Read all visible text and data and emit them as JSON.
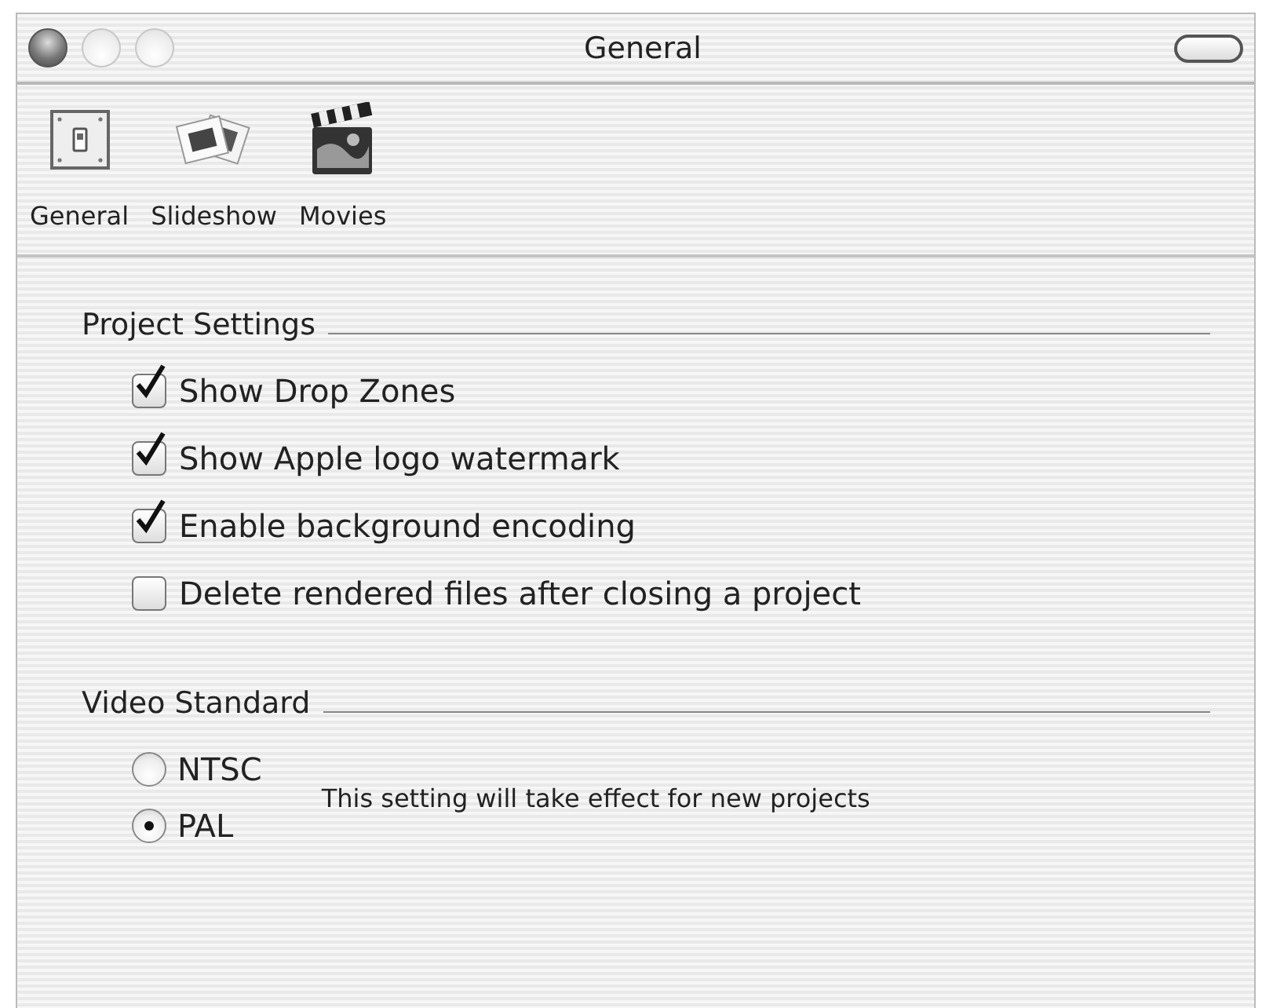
{
  "window": {
    "title": "General"
  },
  "toolbar": [
    {
      "kind": "switch",
      "label": "General"
    },
    {
      "kind": "slides",
      "label": "Slideshow"
    },
    {
      "kind": "clapper",
      "label": "Movies"
    }
  ],
  "sections": [
    {
      "title": "Project Settings",
      "checkboxes": [
        {
          "label": "Show Drop Zones",
          "checked": true
        },
        {
          "label": "Show Apple logo watermark",
          "checked": true
        },
        {
          "label": "Enable background encoding",
          "checked": true
        },
        {
          "label": "Delete rendered files after closing a project",
          "checked": false
        }
      ]
    },
    {
      "title": "Video Standard",
      "radios": [
        {
          "label": "NTSC",
          "selected": false
        },
        {
          "label": "PAL",
          "selected": true
        }
      ],
      "note": "This setting will take effect for new projects"
    }
  ]
}
